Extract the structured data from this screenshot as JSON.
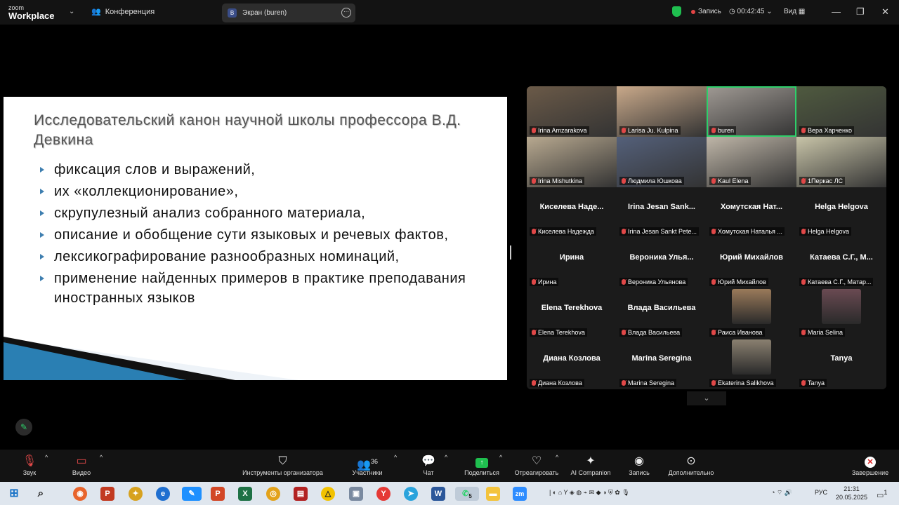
{
  "titlebar": {
    "app_logo_top": "zoom",
    "app_logo_bottom": "Workplace",
    "conference_label": "Конференция",
    "screen_pill_initial": "B",
    "screen_pill_label": "Экран (buren)",
    "record_label": "Запись",
    "timer": "00:42:45",
    "view_label": "Вид"
  },
  "slide": {
    "title": "Исследовательский канон научной школы профессора В.Д. Девкина",
    "bullets": [
      "фиксация слов и выражений,",
      "их «коллекционирование»,",
      "скрупулезный анализ собранного материала,",
      "описание и обобщение сути языковых и речевых фактов,",
      " лексикографирование разнообразных номинаций,",
      " применение найденных примеров в практике преподавания иностранных языков"
    ]
  },
  "gallery": {
    "tiles": [
      {
        "name": "",
        "label": "Irina Amzarakova",
        "video": true,
        "color": "#6b5a48"
      },
      {
        "name": "",
        "label": "Larisa Ju. Kulpina",
        "video": true,
        "color": "#c9a98a"
      },
      {
        "name": "",
        "label": "buren",
        "video": true,
        "color": "#a09a94",
        "active": true
      },
      {
        "name": "",
        "label": "Вера Харченко",
        "video": true,
        "color": "#4f5a3f"
      },
      {
        "name": "",
        "label": "Irina Mishutkina",
        "video": true,
        "color": "#b8a990"
      },
      {
        "name": "",
        "label": "Людмила Юшкова",
        "video": true,
        "color": "#54607a"
      },
      {
        "name": "",
        "label": "Kaul Elena",
        "video": true,
        "color": "#bfb6a8"
      },
      {
        "name": "",
        "label": "1Перкас ЛС",
        "video": true,
        "color": "#c8c4a8"
      },
      {
        "name": "Киселева  Наде...",
        "label": "Киселева Надежда"
      },
      {
        "name": "Irina Jesan Sank...",
        "label": "Irina Jesan Sankt Pete..."
      },
      {
        "name": "Хомутская  Нат...",
        "label": "Хомутская Наталья ..."
      },
      {
        "name": "Helga Helgova",
        "label": "Helga Helgova"
      },
      {
        "name": "Ирина",
        "label": "Ирина"
      },
      {
        "name": "Вероника  Улья...",
        "label": "Вероника Ульянова"
      },
      {
        "name": "Юрий Михайлов",
        "label": "Юрий Михайлов"
      },
      {
        "name": "Катаева С.Г., М...",
        "label": "Катаева С.Г., Матар..."
      },
      {
        "name": "Elena Terekhova",
        "label": "Elena Terekhova"
      },
      {
        "name": "Влада Васильева",
        "label": "Влада Васильева"
      },
      {
        "name": "",
        "label": "Раиса Иванова",
        "avatar": "#9a7a5a"
      },
      {
        "name": "",
        "label": "Maria Selina",
        "avatar": "#6a4a52"
      },
      {
        "name": "Диана Козлова",
        "label": "Диана Козлова"
      },
      {
        "name": "Marina Seregina",
        "label": "Marina Seregina"
      },
      {
        "name": "",
        "label": "Ekaterina Salikhova",
        "avatar": "#8a8070"
      },
      {
        "name": "Tanya",
        "label": "Tanya"
      }
    ],
    "more_icon": "chevron-down"
  },
  "toolbar": {
    "audio": "Звук",
    "video": "Видео",
    "host_tools": "Инструменты организатора",
    "participants": "Участники",
    "participants_count": "36",
    "chat": "Чат",
    "share": "Поделиться",
    "react": "Отреагировать",
    "ai": "AI Companion",
    "record": "Запись",
    "more": "Дополнительно",
    "end": "Завершение"
  },
  "taskbar": {
    "lang": "РУС",
    "time": "21:31",
    "date": "20.05.2025",
    "notifications": "1",
    "zoom_label": "zm",
    "whatsapp_badge": "5"
  },
  "colors": {
    "accent_green": "#2ecf6a",
    "record_red": "#e24444",
    "bullet_blue": "#3f7fb0"
  }
}
